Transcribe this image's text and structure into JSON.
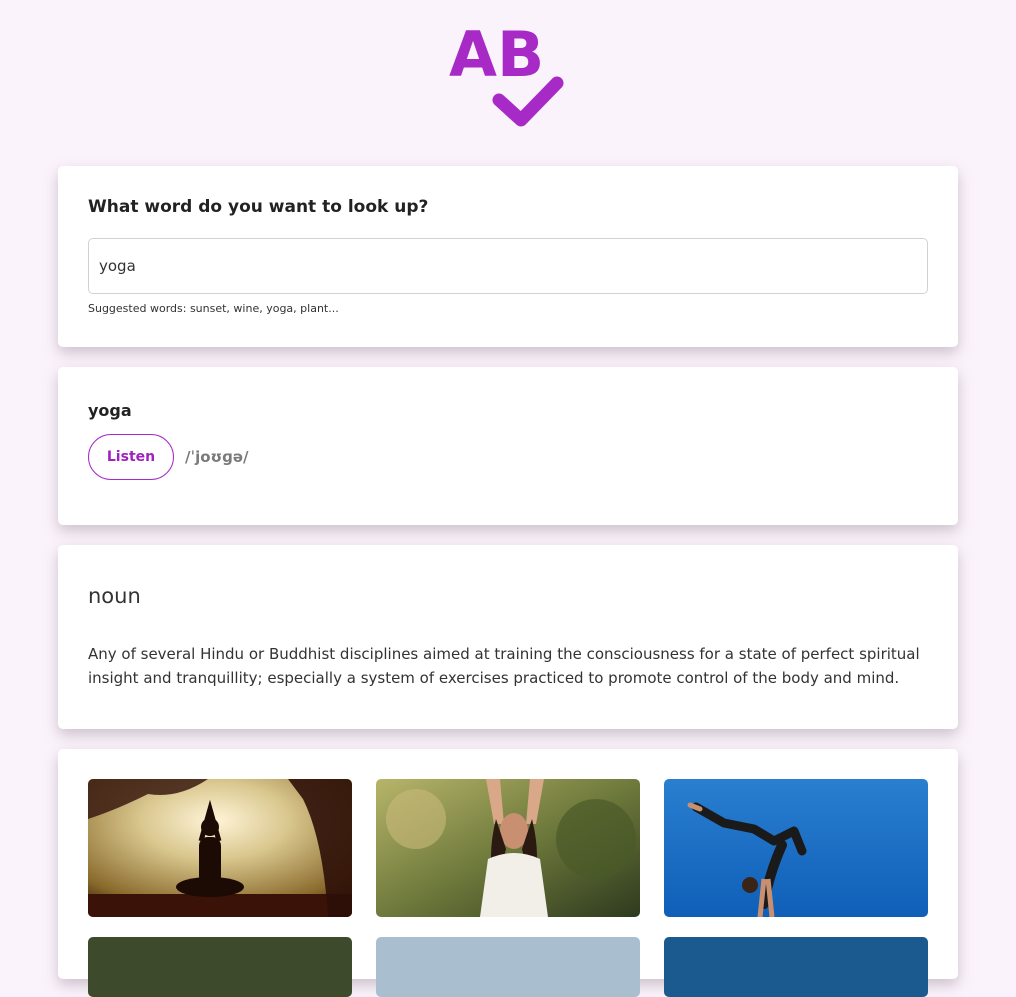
{
  "header": {
    "logo_text": "AB"
  },
  "search": {
    "title": "What word do you want to look up?",
    "value": "yoga",
    "placeholder": "",
    "hint": "Suggested words: sunset, wine, yoga, plant..."
  },
  "word": {
    "title": "yoga",
    "listen_label": "Listen",
    "phonetic": "/ˈjoʊɡə/"
  },
  "definition": {
    "part_of_speech": "noun",
    "text": "Any of several Hindu or Buddhist disciplines aimed at training the consciousness for a state of perfect spiritual insight and tranquillity; especially a system of exercises practiced to promote control of the body and mind."
  },
  "colors": {
    "accent": "#a72ac7",
    "background": "#fbf3fb"
  }
}
